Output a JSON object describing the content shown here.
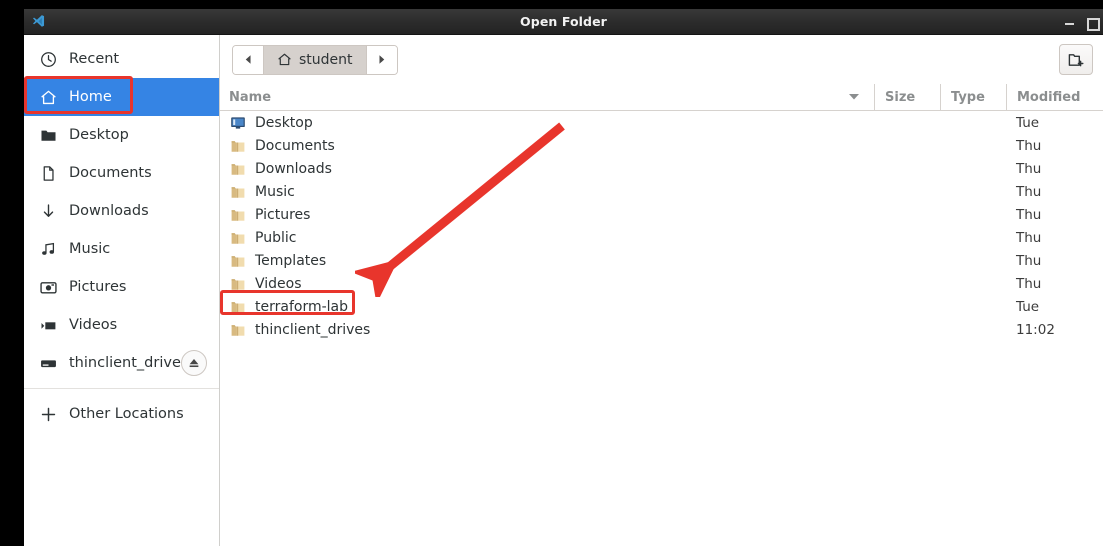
{
  "window": {
    "title": "Open Folder",
    "app_icon": "vscode-icon",
    "controls": {
      "minimize": "minimize-button",
      "maximize": "maximize-button"
    }
  },
  "sidebar": {
    "items": [
      {
        "label": "Recent",
        "icon": "clock-icon",
        "selected": false,
        "eject": false
      },
      {
        "label": "Home",
        "icon": "home-icon",
        "selected": true,
        "eject": false
      },
      {
        "label": "Desktop",
        "icon": "folder-icon",
        "selected": false,
        "eject": false
      },
      {
        "label": "Documents",
        "icon": "document-icon",
        "selected": false,
        "eject": false
      },
      {
        "label": "Downloads",
        "icon": "download-icon",
        "selected": false,
        "eject": false
      },
      {
        "label": "Music",
        "icon": "music-icon",
        "selected": false,
        "eject": false
      },
      {
        "label": "Pictures",
        "icon": "camera-icon",
        "selected": false,
        "eject": false
      },
      {
        "label": "Videos",
        "icon": "video-icon",
        "selected": false,
        "eject": false
      },
      {
        "label": "thinclient_drives",
        "icon": "drive-icon",
        "selected": false,
        "eject": true
      }
    ],
    "other_locations": {
      "label": "Other Locations",
      "icon": "plus-icon"
    }
  },
  "pathbar": {
    "back": "back-arrow-icon",
    "forward": "forward-arrow-icon",
    "current": "student",
    "current_icon": "home-icon",
    "new_folder": "new-folder-icon"
  },
  "columns": {
    "name": "Name",
    "size": "Size",
    "type": "Type",
    "modified": "Modified",
    "sort_icon": "sort-descending-caret"
  },
  "files": [
    {
      "name": "Desktop",
      "icon": "monitor-icon",
      "size": "",
      "type": "",
      "modified": "Tue",
      "highlighted": false
    },
    {
      "name": "Documents",
      "icon": "folder-icon",
      "size": "",
      "type": "",
      "modified": "Thu",
      "highlighted": false
    },
    {
      "name": "Downloads",
      "icon": "folder-icon",
      "size": "",
      "type": "",
      "modified": "Thu",
      "highlighted": false
    },
    {
      "name": "Music",
      "icon": "folder-icon",
      "size": "",
      "type": "",
      "modified": "Thu",
      "highlighted": false
    },
    {
      "name": "Pictures",
      "icon": "folder-icon",
      "size": "",
      "type": "",
      "modified": "Thu",
      "highlighted": false
    },
    {
      "name": "Public",
      "icon": "folder-icon",
      "size": "",
      "type": "",
      "modified": "Thu",
      "highlighted": false
    },
    {
      "name": "Templates",
      "icon": "folder-icon",
      "size": "",
      "type": "",
      "modified": "Thu",
      "highlighted": false
    },
    {
      "name": "Videos",
      "icon": "folder-icon",
      "size": "",
      "type": "",
      "modified": "Thu",
      "highlighted": false
    },
    {
      "name": "terraform-lab",
      "icon": "folder-icon",
      "size": "",
      "type": "",
      "modified": "Tue",
      "highlighted": true
    },
    {
      "name": "thinclient_drives",
      "icon": "folder-icon",
      "size": "",
      "type": "",
      "modified": "11:02",
      "highlighted": false
    }
  ],
  "annotations": {
    "color": "#e8352c",
    "boxes": [
      {
        "target": "sidebar-item-home"
      },
      {
        "target": "file-row-terraform-lab"
      }
    ],
    "arrow": {
      "from": "upper-right",
      "to": "file-row-terraform-lab"
    }
  }
}
